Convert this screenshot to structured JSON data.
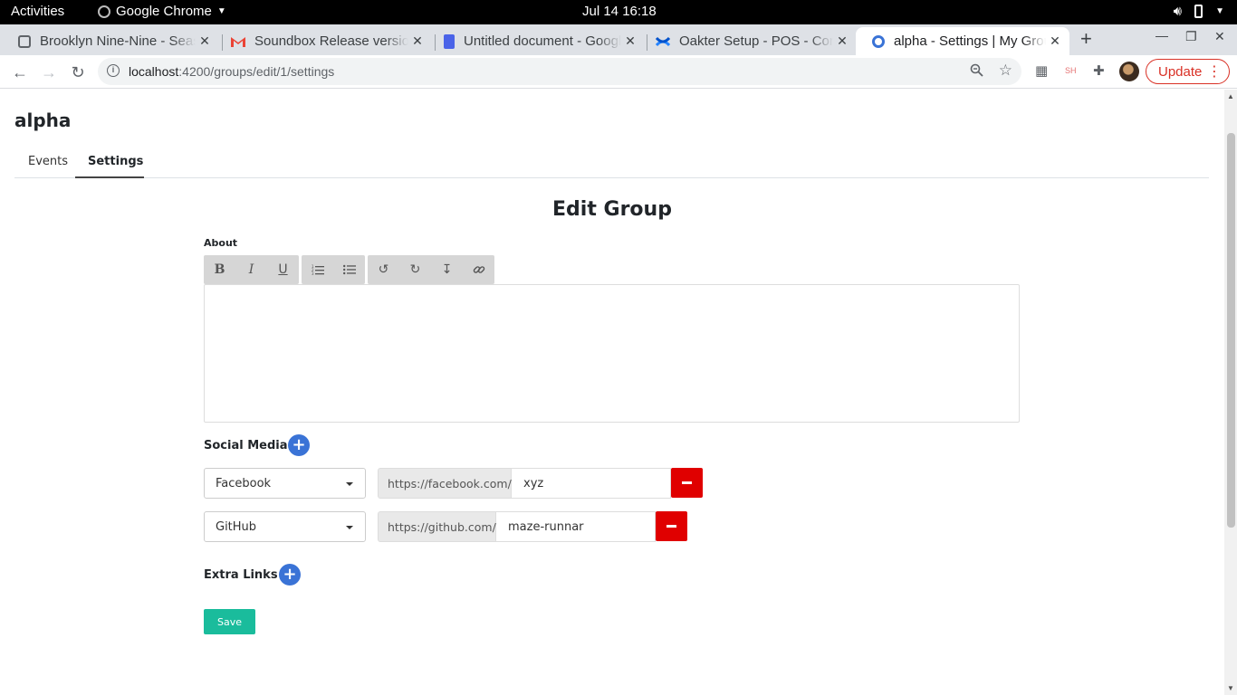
{
  "system_bar": {
    "activities": "Activities",
    "app_name": "Google Chrome",
    "clock": "Jul 14  16:18"
  },
  "browser": {
    "tabs": [
      {
        "title": "Brooklyn Nine-Nine - Season",
        "icon": "search-favicon"
      },
      {
        "title": "Soundbox Release version",
        "icon": "gmail-icon"
      },
      {
        "title": "Untitled document - Google Docs",
        "icon": "docs-icon"
      },
      {
        "title": "Oakter Setup - POS - Confluence",
        "icon": "confluence-icon"
      },
      {
        "title": "alpha - Settings | My Groups",
        "icon": "app-favicon",
        "active": true
      }
    ],
    "url_host": "localhost",
    "url_rest": ":4200/groups/edit/1/settings",
    "update_label": "Update"
  },
  "page": {
    "group_name": "alpha",
    "tabs": [
      {
        "label": "Events"
      },
      {
        "label": "Settings",
        "active": true
      }
    ],
    "form_title": "Edit Group",
    "about_label": "About",
    "editor_content": "",
    "social_media_label": "Social Media",
    "social_links": [
      {
        "platform": "Facebook",
        "prefix": "https://facebook.com/",
        "value": "xyz"
      },
      {
        "platform": "GitHub",
        "prefix": "https://github.com/",
        "value": "maze-runnar"
      }
    ],
    "extra_links_label": "Extra Links",
    "save_label": "Save"
  },
  "colors": {
    "accent_blue": "#3a73d6",
    "danger_red": "#e00000",
    "save_teal": "#1abc9c",
    "update_red": "#d93025"
  }
}
